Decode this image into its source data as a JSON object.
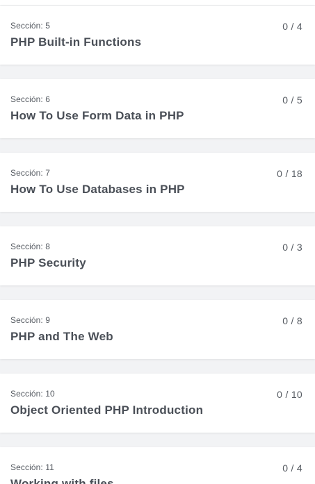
{
  "sections": [
    {
      "label": "Sección: 5",
      "title": "PHP Built-in Functions",
      "progress": "0 / 4"
    },
    {
      "label": "Sección: 6",
      "title": "How To Use Form Data in PHP",
      "progress": "0 / 5"
    },
    {
      "label": "Sección: 7",
      "title": "How To Use Databases in PHP",
      "progress": "0 / 18"
    },
    {
      "label": "Sección: 8",
      "title": "PHP Security",
      "progress": "0 / 3"
    },
    {
      "label": "Sección: 9",
      "title": "PHP and The Web",
      "progress": "0 / 8"
    },
    {
      "label": "Sección: 10",
      "title": "Object Oriented PHP Introduction",
      "progress": "0 / 10"
    },
    {
      "label": "Sección: 11",
      "title": "Working with files",
      "progress": "0 / 4"
    }
  ]
}
